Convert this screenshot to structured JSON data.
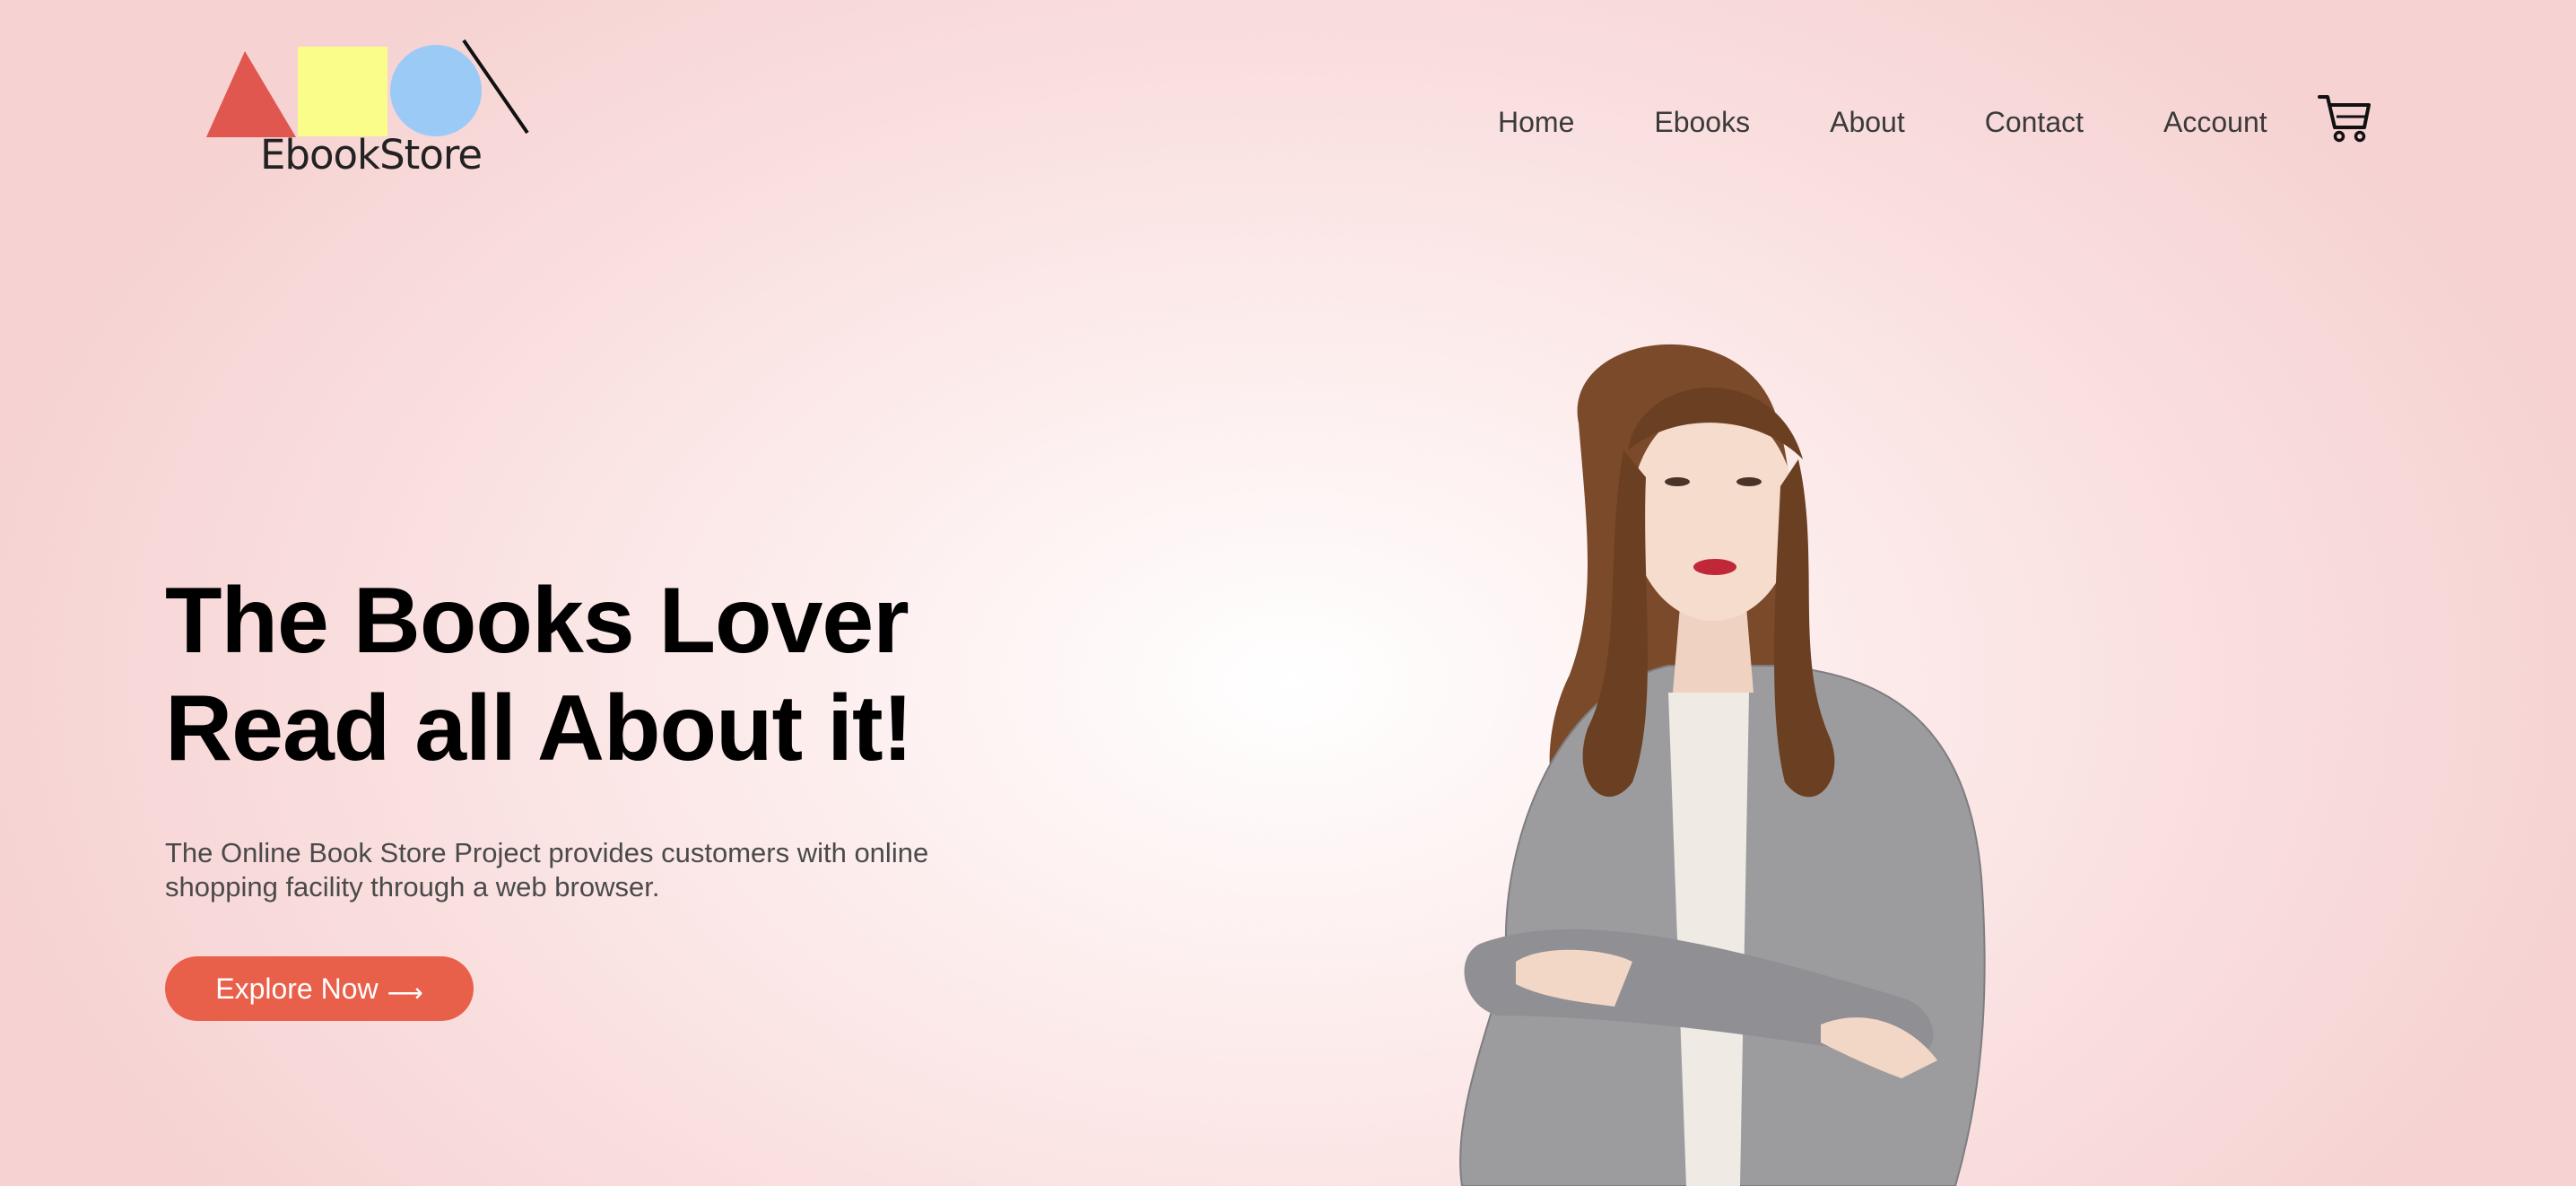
{
  "brand": {
    "name": "EbookStore",
    "colors": {
      "triangle": "#e0574f",
      "square": "#fbfd8a",
      "circle": "#9ccaf7",
      "accent": "#e9604a"
    }
  },
  "nav": {
    "items": [
      {
        "label": "Home"
      },
      {
        "label": "Ebooks"
      },
      {
        "label": "About"
      },
      {
        "label": "Contact"
      },
      {
        "label": "Account"
      }
    ],
    "cart_icon": "shopping-cart-icon"
  },
  "hero": {
    "title_line1": "The Books Lover",
    "title_line2": "Read all About it!",
    "description_line1": "The Online Book Store Project provides customers with online",
    "description_line2": "shopping facility through a web browser.",
    "cta_label": "Explore Now",
    "cta_arrow": "⟶"
  }
}
